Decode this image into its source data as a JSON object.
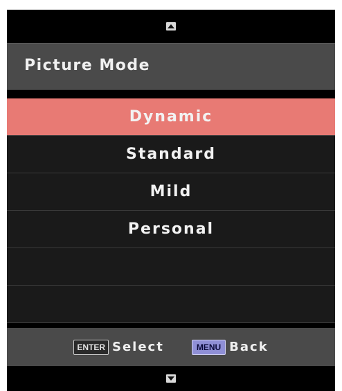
{
  "title": "Picture Mode",
  "items": [
    {
      "label": "Dynamic",
      "selected": true
    },
    {
      "label": "Standard",
      "selected": false
    },
    {
      "label": "Mild",
      "selected": false
    },
    {
      "label": "Personal",
      "selected": false
    },
    {
      "label": "",
      "selected": false
    },
    {
      "label": "",
      "selected": false
    }
  ],
  "footer": {
    "enter_key": "ENTER",
    "enter_label": "Select",
    "menu_key": "MENU",
    "menu_label": "Back"
  },
  "icons": {
    "scroll_up": "triangle-up-icon",
    "scroll_down": "triangle-down-icon"
  },
  "colors": {
    "selected_item": "#e87a74",
    "title_bar": "#4a4a4a",
    "menu_key": "#8f8fd6"
  }
}
